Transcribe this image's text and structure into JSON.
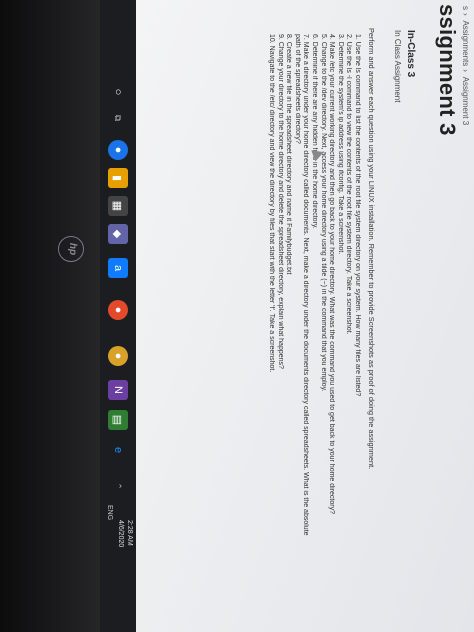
{
  "breadcrumb": {
    "parts": [
      "s",
      "Assignments",
      "Assignment 3"
    ]
  },
  "page": {
    "title": "ssignment 3",
    "subtitle": "In-Class 3",
    "kind": "In Class Assignment",
    "intro": "Perform and answer each question using your LINUX installation. Remember to provide Screenshots as proof of doing the assignment.",
    "steps": [
      "1. Use the ls command to list the contents of the root file system directory on your system. How many files are listed?",
      "2. Use the ls -l command to view the contents of the root file system directory. Take a screenshot.",
      "3. Determine the system's ip address using ifconfig. Take a screenshot.",
      "4. Make /etc your current working directory and then go back to your home directory. What was the command you used to get back to your home directory?",
      "5. Change to the /dev directory. Next, access your home directory using a tilde (~) in the command that you employ.",
      "6. Determine if there are any hidden files in the home directory.",
      "7. Make a directory under your home directory called documents. Next, make a directory under the documents directory called spreadsheets. What is the absolute",
      "   path of the spreadsheets directory?",
      "8. Create a new file in the spreadsheet directory and name it Familybudget.txt",
      "9. Change your directory to the home directory and delete the spreadsheet directory, explain what happens?",
      "10. Navigate to the /etc/ directory and view the directory by files that start with the letter 'f'. Take a screenshot."
    ]
  },
  "taskbar": {
    "lang": "ENG",
    "time": "2:28 AM",
    "date": "4/6/2020"
  },
  "brand": {
    "logo": "hp"
  },
  "colors": {
    "taskbar": "#1c1d21",
    "page_bg": "#eceef0",
    "text": "#2a2a2e"
  }
}
